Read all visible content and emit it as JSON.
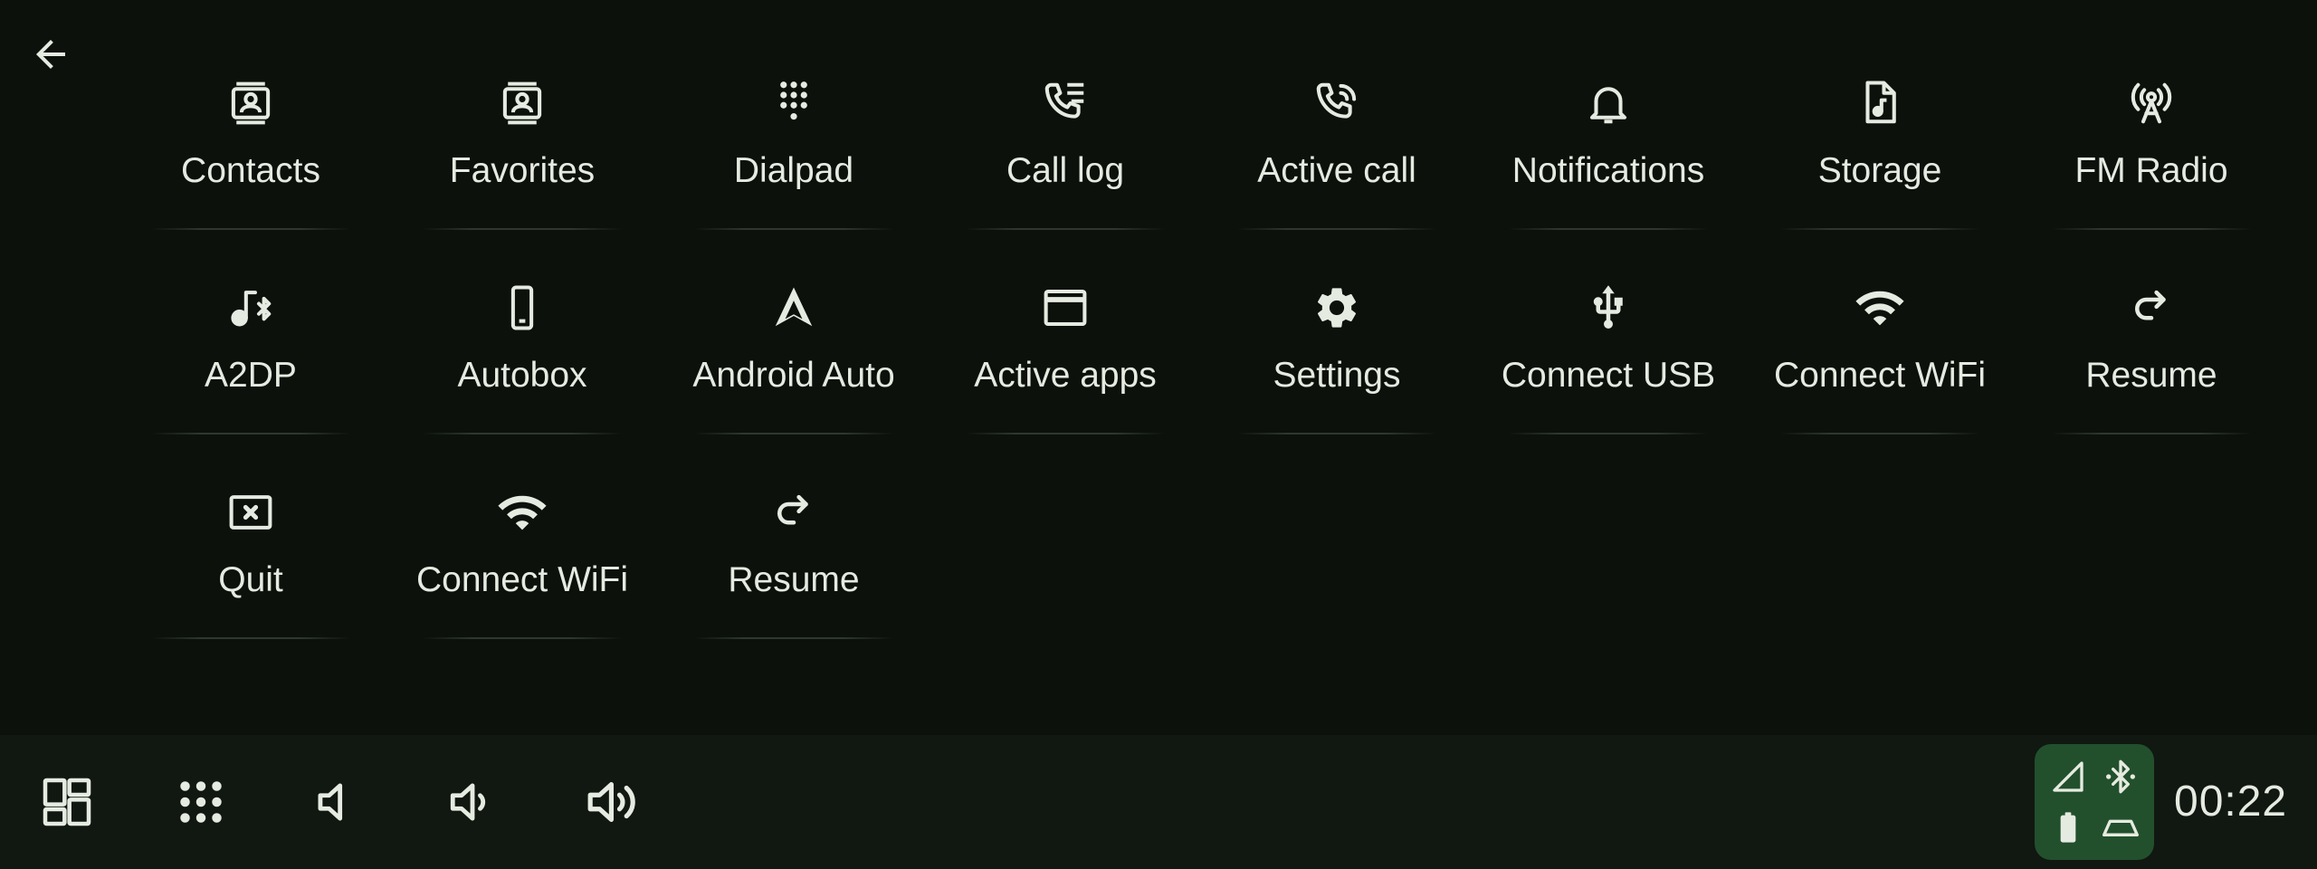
{
  "header": {
    "back_icon": "arrow-left-icon"
  },
  "tiles": [
    {
      "label": "Contacts",
      "icon": "contact-card-icon"
    },
    {
      "label": "Favorites",
      "icon": "contact-card-icon"
    },
    {
      "label": "Dialpad",
      "icon": "dialpad-icon"
    },
    {
      "label": "Call log",
      "icon": "call-log-icon"
    },
    {
      "label": "Active call",
      "icon": "phone-in-talk-icon"
    },
    {
      "label": "Notifications",
      "icon": "bell-icon"
    },
    {
      "label": "Storage",
      "icon": "music-file-icon"
    },
    {
      "label": "FM Radio",
      "icon": "radio-tower-icon"
    },
    {
      "label": "A2DP",
      "icon": "bluetooth-audio-icon"
    },
    {
      "label": "Autobox",
      "icon": "phone-device-icon"
    },
    {
      "label": "Android Auto",
      "icon": "android-auto-icon"
    },
    {
      "label": "Active apps",
      "icon": "window-icon"
    },
    {
      "label": "Settings",
      "icon": "gear-icon"
    },
    {
      "label": "Connect USB",
      "icon": "usb-icon"
    },
    {
      "label": "Connect WiFi",
      "icon": "wifi-icon"
    },
    {
      "label": "Resume",
      "icon": "redo-icon"
    },
    {
      "label": "Quit",
      "icon": "close-box-icon"
    },
    {
      "label": "Connect WiFi",
      "icon": "wifi-icon"
    },
    {
      "label": "Resume",
      "icon": "redo-icon"
    }
  ],
  "bottom_bar": {
    "buttons": [
      {
        "icon": "dashboard-icon"
      },
      {
        "icon": "apps-grid-icon"
      },
      {
        "icon": "volume-mute-icon"
      },
      {
        "icon": "volume-down-icon"
      },
      {
        "icon": "volume-up-icon"
      }
    ],
    "status_icons": [
      "cell-signal-icon",
      "bluetooth-icon",
      "battery-icon",
      "car-icon"
    ],
    "clock": "00:22"
  },
  "colors": {
    "background": "#0c110c",
    "bottom_bar": "#111711",
    "status_panel": "#22502c",
    "foreground": "#e6ebe1"
  }
}
